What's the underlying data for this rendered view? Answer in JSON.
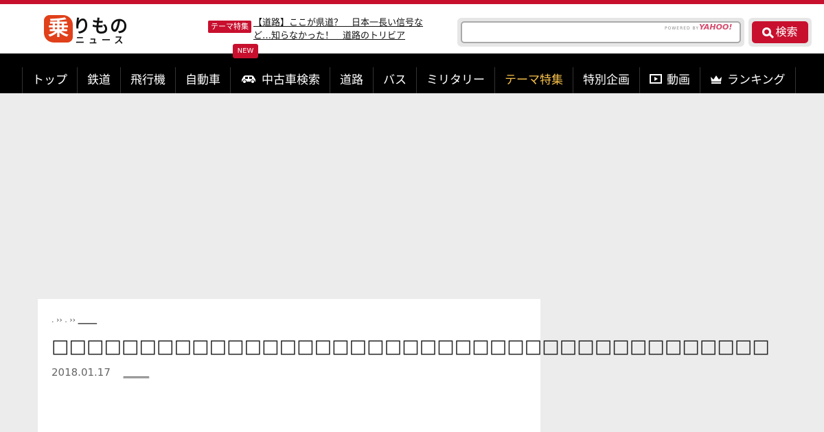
{
  "brand": {
    "logo_mark": "乗",
    "logo_text": "りもの",
    "logo_sub": "ニュース"
  },
  "feature": {
    "tag": "テーマ特集",
    "link": "【道路】ここが県道？　日本一長い信号など…知らなかった！　道路のトリビア"
  },
  "search": {
    "value": "",
    "powered": "POWERED BY",
    "provider": "YAHOO!",
    "button_label": "検索"
  },
  "nav": {
    "new_badge": "NEW",
    "items": [
      {
        "label": "トップ"
      },
      {
        "label": "鉄道"
      },
      {
        "label": "飛行機"
      },
      {
        "label": "自動車"
      },
      {
        "label": "中古車検索",
        "icon": "car-icon"
      },
      {
        "label": "道路"
      },
      {
        "label": "バス"
      },
      {
        "label": "ミリタリー"
      },
      {
        "label": "テーマ特集",
        "active": true
      },
      {
        "label": "特別企画"
      },
      {
        "label": "動画",
        "icon": "video-icon"
      },
      {
        "label": "ランキング",
        "icon": "crown-icon"
      }
    ],
    "active_color": "#f6c04a"
  },
  "article": {
    "breadcrumb_sep1": ". ›› . ››",
    "breadcrumb_cat": "_____",
    "title": "□□□□□□□□□□□□□□□□□□□□□□□□□□□□□□□□□□□□□□□□□",
    "date": "2018.01.17",
    "author": "_____"
  },
  "colors": {
    "accent": "#c8102e",
    "nav_bg": "#000000",
    "page_bg": "#ececec"
  }
}
